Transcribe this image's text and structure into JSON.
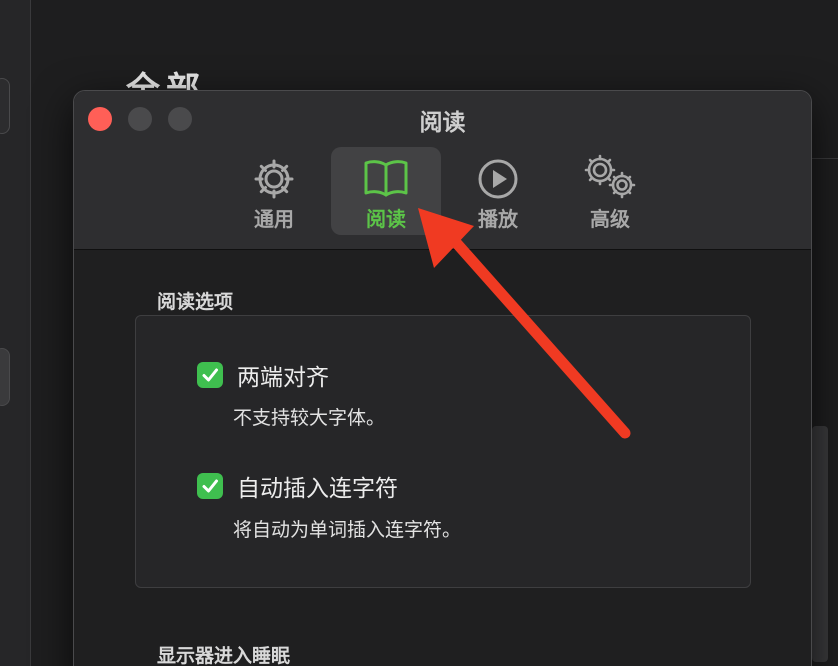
{
  "background": {
    "heading": "全部"
  },
  "window": {
    "title": "阅读",
    "traffic_lights": {
      "close_color": "#ff5f57",
      "inactive_color": "#4a4a4c"
    }
  },
  "toolbar": {
    "tabs": [
      {
        "label": "通用",
        "icon": "gear-icon",
        "active": false
      },
      {
        "label": "阅读",
        "icon": "book-icon",
        "active": true
      },
      {
        "label": "播放",
        "icon": "play-circle-icon",
        "active": false
      },
      {
        "label": "高级",
        "icon": "gears-icon",
        "active": false
      }
    ],
    "active_color": "#5cc448"
  },
  "reading_options": {
    "section_title": "阅读选项",
    "options": [
      {
        "label": "两端对齐",
        "description": "不支持较大字体。",
        "checked": true
      },
      {
        "label": "自动插入连字符",
        "description": "将自动为单词插入连字符。",
        "checked": true
      }
    ],
    "checkbox_color": "#3fbf4f"
  },
  "display_sleep": {
    "section_title": "显示器进入睡眠"
  },
  "annotation": {
    "arrow_color": "#f03a22",
    "points_to": "阅读 tab"
  }
}
